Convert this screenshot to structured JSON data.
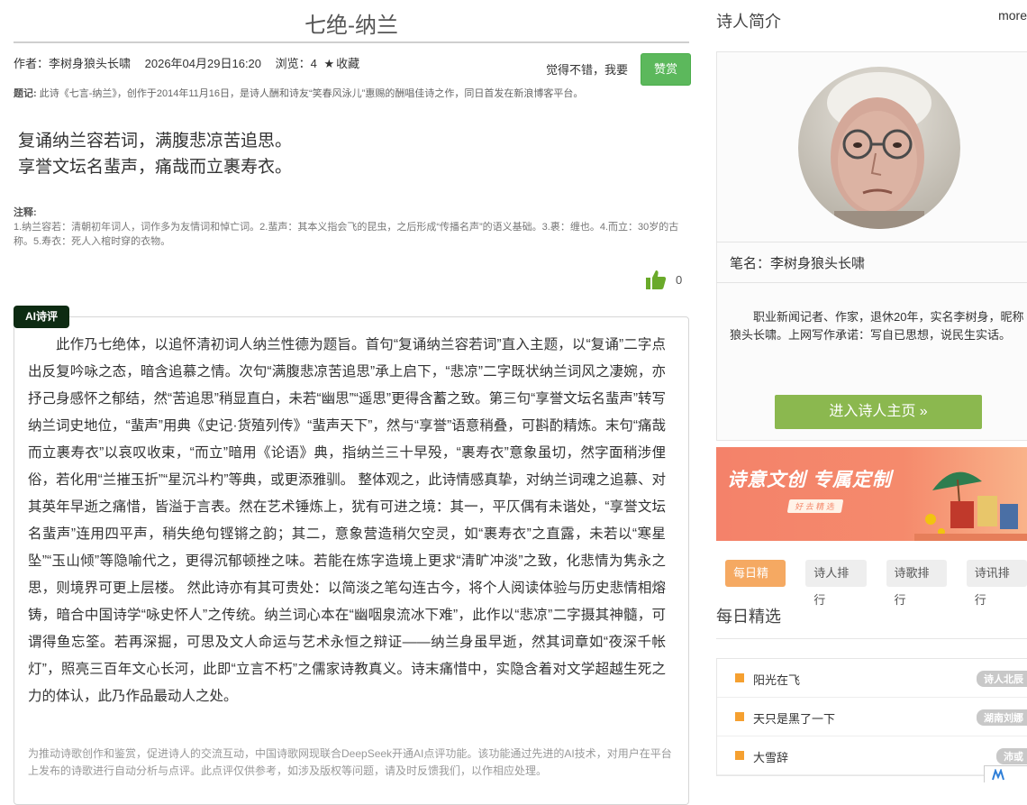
{
  "article": {
    "title": "七绝-纳兰",
    "author_text": "作者：李树身狼头长啸",
    "date_text": "2026年04月29日16:20",
    "views_text": "浏览：4",
    "collect_label": "收藏",
    "praise_text": "觉得不错，我要",
    "praise_button": "赞赏",
    "note_label": "题记:",
    "note_text": "此诗《七言-纳兰》，创作于2014年11月16日，是诗人酬和诗友“笑春风泳儿”惠赐的酬唱佳诗之作，同日首发在新浪博客平台。",
    "poem_line1": "复诵纳兰容若词，满腹悲凉苦追思。",
    "poem_line2": "享誉文坛名蜚声，痛哉而立裹寿衣。",
    "annot_label": "注释:",
    "annot_text": "1.纳兰容若：清朝初年词人，词作多为友情词和悼亡词。2.蜚声：其本义指会飞的昆虫，之后形成“传播名声”的语义基础。3.裹：缠也。4.而立：30岁的古称。5.寿衣：死人入棺时穿的衣物。",
    "like_count": "0"
  },
  "ai_review": {
    "badge": "AI诗评",
    "text": "此作乃七绝体，以追怀清初词人纳兰性德为题旨。首句“复诵纳兰容若词”直入主题，以“复诵”二字点出反复吟咏之态，暗含追慕之情。次句“满腹悲凉苦追思”承上启下，“悲凉”二字既状纳兰词风之凄婉，亦抒己身感怀之郁结，然“苦追思”稍显直白，未若“幽思”“遥思”更得含蓄之致。第三句“享誉文坛名蜚声”转写纳兰词史地位，“蜚声”用典《史记·货殖列传》“蜚声天下”，然与“享誉”语意稍叠，可斟酌精炼。末句“痛哉而立裹寿衣”以哀叹收束，“而立”暗用《论语》典，指纳兰三十早殁，“裹寿衣”意象虽切，然字面稍涉俚俗，若化用“兰摧玉折”“星沉斗杓”等典，或更添雅驯。 整体观之，此诗情感真挚，对纳兰词魂之追慕、对其英年早逝之痛惜，皆溢于言表。然在艺术锤炼上，犹有可进之境：其一，平仄偶有未谐处，“享誉文坛名蜚声”连用四平声，稍失绝句铿锵之韵；其二，意象营造稍欠空灵，如“裹寿衣”之直露，未若以“寒星坠”“玉山倾”等隐喻代之，更得沉郁顿挫之味。若能在炼字造境上更求“清旷冲淡”之致，化悲情为隽永之思，则境界可更上层楼。 然此诗亦有其可贵处：以简淡之笔勾连古今，将个人阅读体验与历史悲情相熔铸，暗合中国诗学“咏史怀人”之传统。纳兰词心本在“幽咽泉流冰下难”，此作以“悲凉”二字摄其神髓，可谓得鱼忘筌。若再深掘，可思及文人命运与艺术永恒之辩证——纳兰身虽早逝，然其词章如“夜深千帐灯”，照亮三百年文心长河，此即“立言不朽”之儒家诗教真义。诗末痛惜中，实隐含着对文学超越生死之力的体认，此乃作品最动人之处。",
    "footer": "为推动诗歌创作和鉴赏，促进诗人的交流互动，中国诗歌网现联合DeepSeek开通AI点评功能。该功能通过先进的AI技术，对用户在平台上发布的诗歌进行自动分析与点评。此点评仅供参考，如涉及版权等问题，请及时反馈我们，以作相应处理。"
  },
  "sidebar": {
    "heading": "诗人简介",
    "more": "more",
    "penname": "笔名：李树身狼头长啸",
    "bio": "职业新闻记者、作家，退休20年，实名李树身，昵称狼头长啸。上网写作承诺：写自已思想，说民生实话。",
    "enter_button": "进入诗人主页",
    "banner_title": "诗意文创  专属定制",
    "banner_sub": "好 去 精 选",
    "tabs": [
      "每日精选",
      "诗人排行",
      "诗歌排行",
      "诗讯排行"
    ],
    "daily_heading": "每日精选",
    "daily": [
      {
        "title": "阳光在飞",
        "author": "诗人北辰"
      },
      {
        "title": "天只是黑了一下",
        "author": "湖南刘娜"
      },
      {
        "title": "大雪辞",
        "author": "沛或"
      }
    ]
  },
  "colors": {
    "praise_green": "#5cb85c",
    "enter_green": "#8bb84f",
    "active_tab": "#f5a962",
    "ai_badge": "#0d2b12"
  }
}
